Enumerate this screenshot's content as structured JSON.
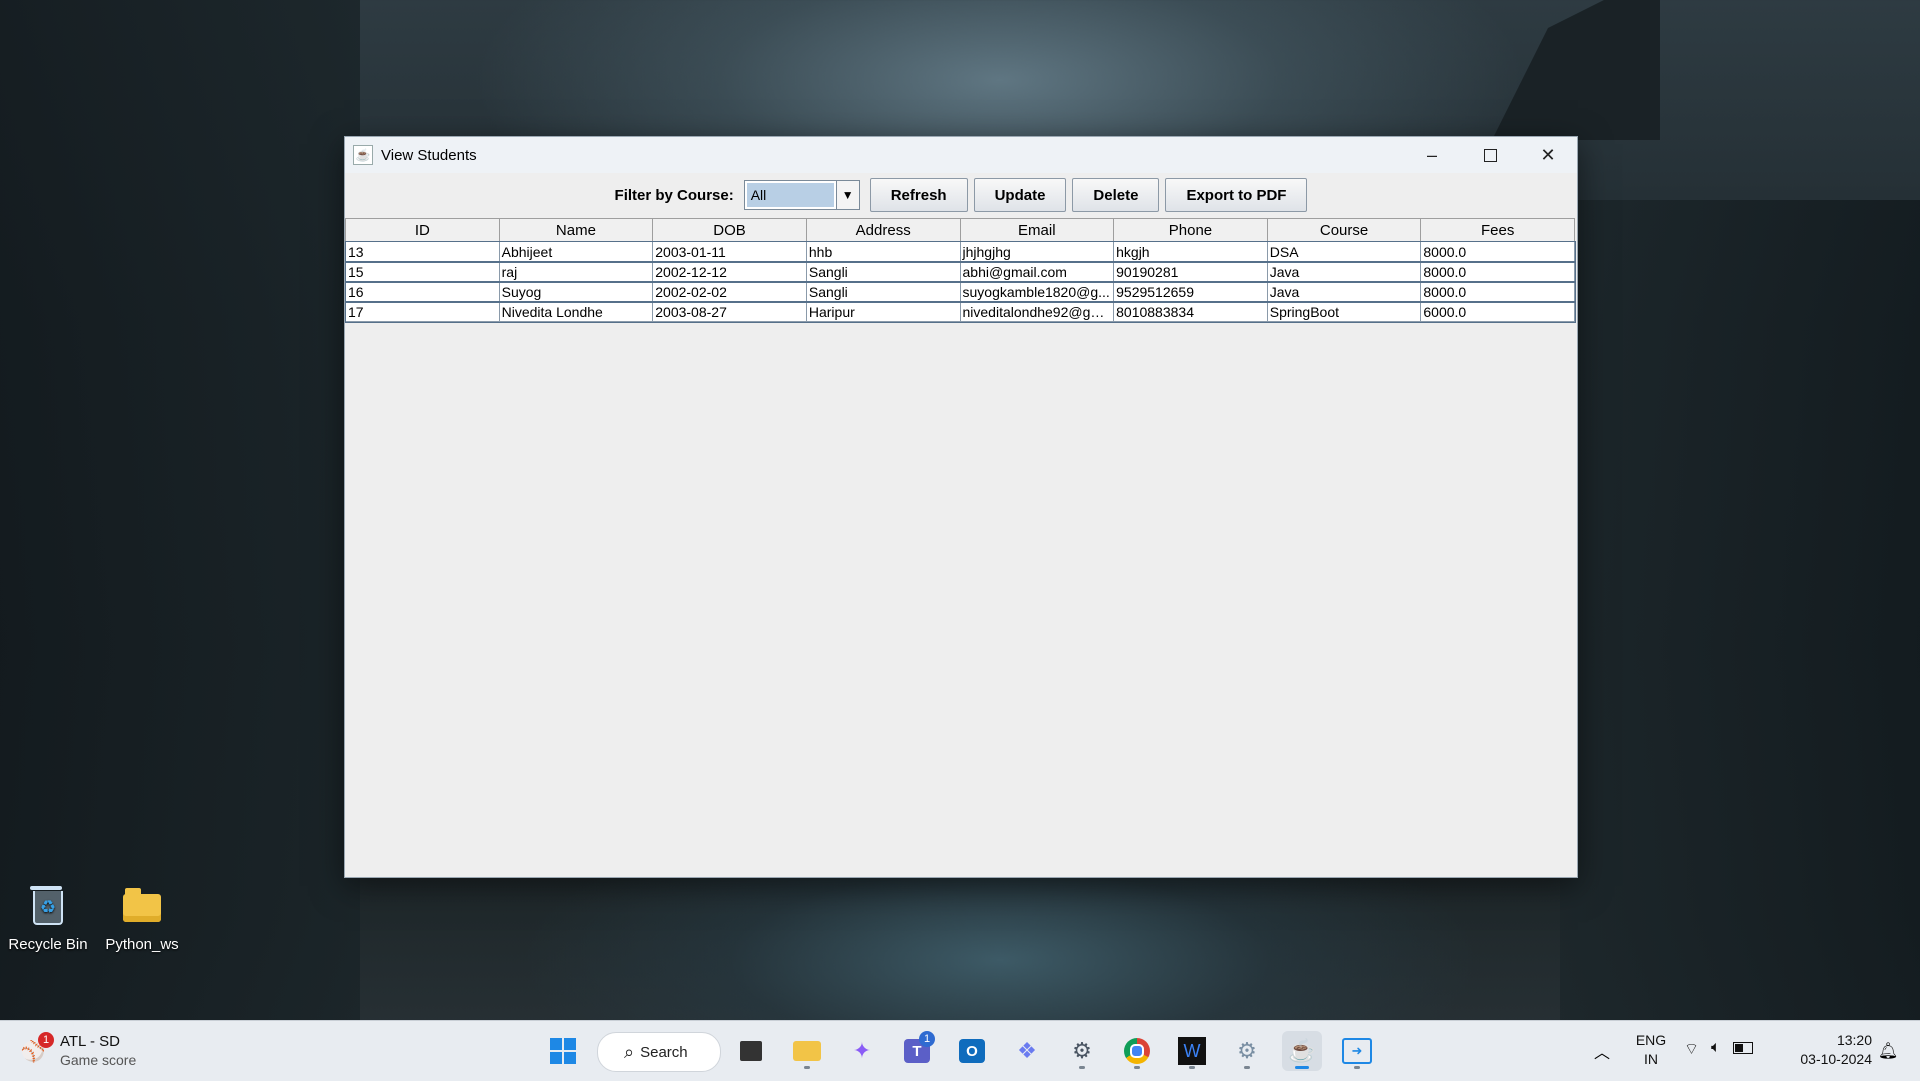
{
  "window": {
    "title": "View Students"
  },
  "toolbar": {
    "filter_label": "Filter by Course:",
    "course_selected": "All",
    "refresh_label": "Refresh",
    "update_label": "Update",
    "delete_label": "Delete",
    "export_label": "Export to PDF"
  },
  "table": {
    "columns": [
      "ID",
      "Name",
      "DOB",
      "Address",
      "Email",
      "Phone",
      "Course",
      "Fees"
    ],
    "rows": [
      [
        "13",
        "Abhijeet",
        "2003-01-11",
        "hhb",
        "jhjhgjhg",
        "hkgjh",
        "DSA",
        "8000.0"
      ],
      [
        "15",
        "raj",
        "2002-12-12",
        "Sangli",
        "abhi@gmail.com",
        "90190281",
        "Java",
        "8000.0"
      ],
      [
        "16",
        "Suyog",
        "2002-02-02",
        "Sangli",
        "suyogkamble1820@g...",
        "9529512659",
        "Java",
        "8000.0"
      ],
      [
        "17",
        "Nivedita Londhe",
        "2003-08-27",
        "Haripur",
        "niveditalondhe92@gm...",
        "8010883834",
        "SpringBoot",
        "6000.0"
      ]
    ]
  },
  "desktop": {
    "icons": [
      {
        "label": "Recycle Bin",
        "icon": "recycle-bin-icon"
      },
      {
        "label": "Python_ws",
        "icon": "folder-icon"
      }
    ]
  },
  "taskbar": {
    "widget_title": "ATL - SD",
    "widget_subtitle": "Game score",
    "widget_badge": "1",
    "search_label": "Search",
    "teams_badge": "1",
    "lang_line1": "ENG",
    "lang_line2": "IN",
    "time": "13:20",
    "date": "03-10-2024"
  },
  "colors": {
    "accent": "#2f6bd1",
    "selection": "#b8cfe5"
  }
}
